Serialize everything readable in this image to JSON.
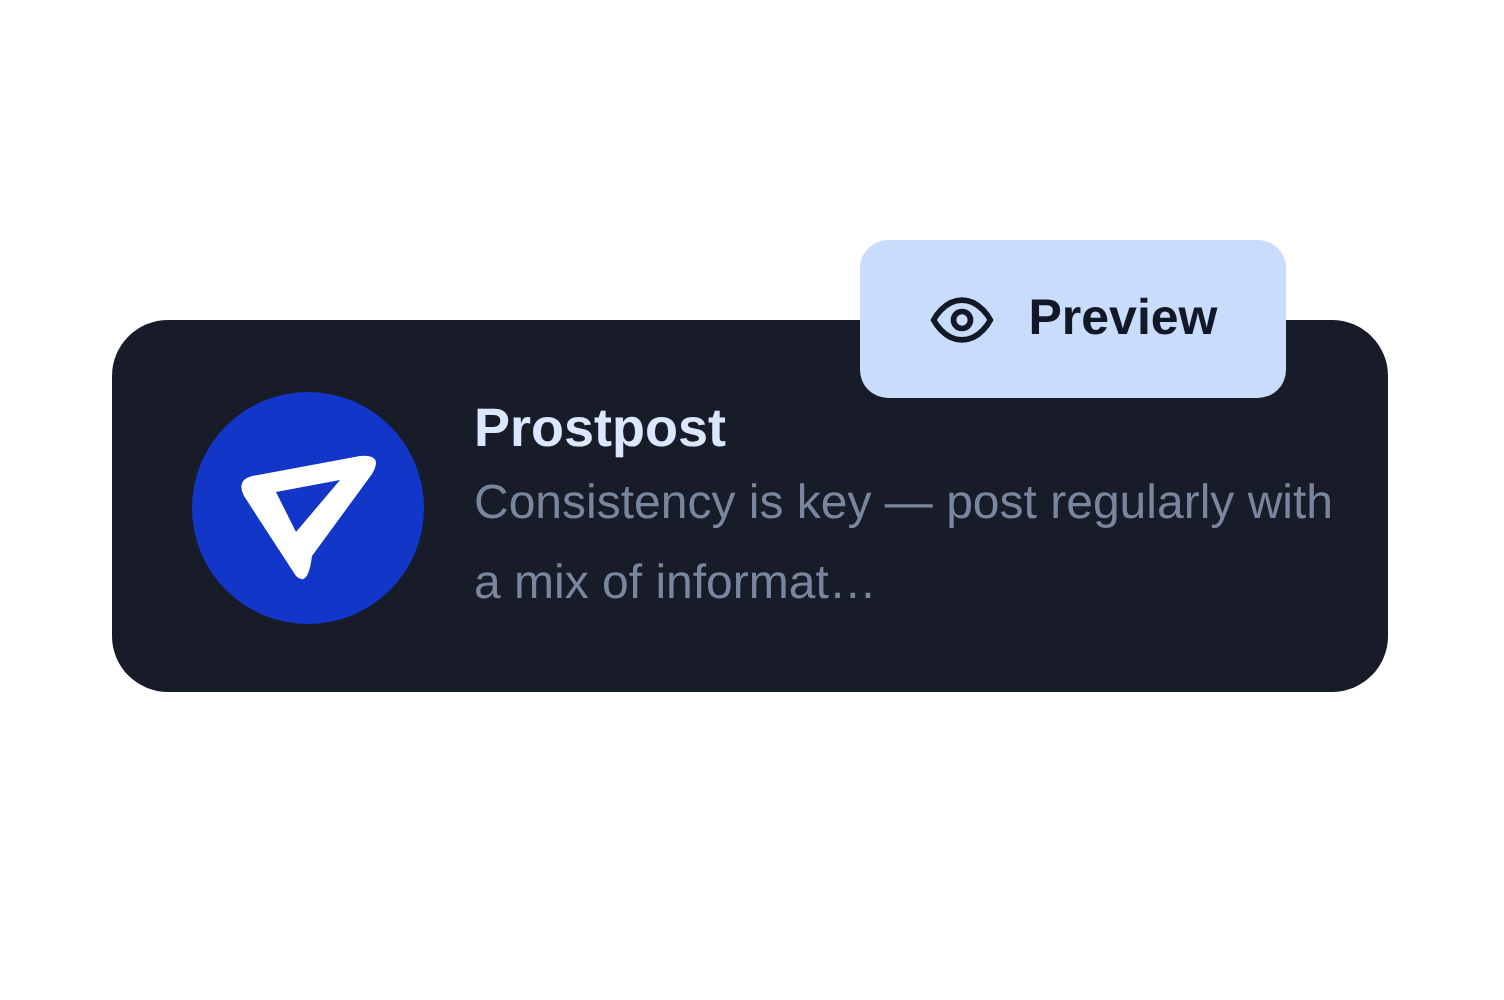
{
  "card": {
    "title": "Prostpost",
    "description": "Consistency is key — post regularly with a mix of informat…"
  },
  "preview_button": {
    "label": "Preview"
  }
}
